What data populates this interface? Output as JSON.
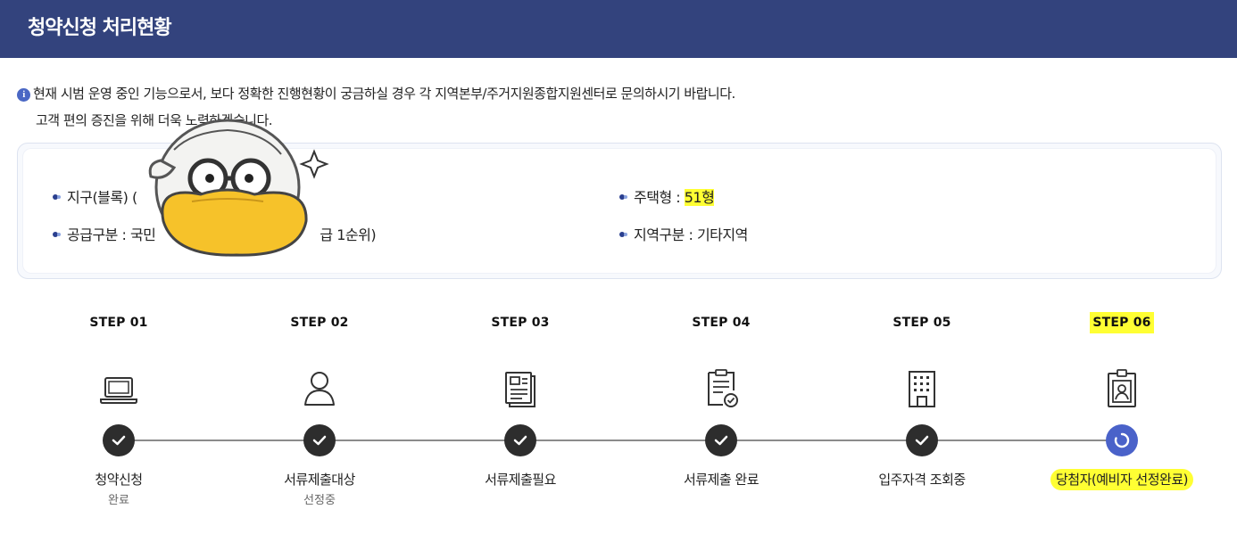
{
  "header": {
    "title": "청약신청 처리현황"
  },
  "notice": {
    "icon": "info-icon",
    "line1": "현재 시범 운영 중인 기능으로서, 보다 정확한 진행현황이 궁금하실 경우 각 지역본부/주거지원종합지원센터로 문의하시기 바랍니다.",
    "line2": "고객 편의 증진을 위해 더욱 노력하겠습니다."
  },
  "info": {
    "district_label": "지구(블록)",
    "district_value": "(",
    "housing_type_label": "주택형 : ",
    "housing_type_value": "51형",
    "supply_label": "공급구분 : 국민",
    "supply_value_tail": "급 1순위)",
    "region_label": "지역구분 : 기타지역"
  },
  "steps": [
    {
      "label": "STEP 01",
      "icon": "laptop-icon",
      "status": "청약신청",
      "sub": "완료",
      "state": "done"
    },
    {
      "label": "STEP 02",
      "icon": "person-icon",
      "status": "서류제출대상",
      "sub": "선정중",
      "state": "done"
    },
    {
      "label": "STEP 03",
      "icon": "document-icon",
      "status": "서류제출필요",
      "sub": "",
      "state": "done"
    },
    {
      "label": "STEP 04",
      "icon": "document-check-icon",
      "status": "서류제출 완료",
      "sub": "",
      "state": "done"
    },
    {
      "label": "STEP 05",
      "icon": "building-icon",
      "status": "입주자격 조회중",
      "sub": "",
      "state": "done"
    },
    {
      "label": "STEP 06",
      "icon": "id-badge-icon",
      "status": "당첨자(예비자 선정완료)",
      "sub": "",
      "state": "active"
    }
  ],
  "colors": {
    "header_bg": "#33437d",
    "highlight": "#ffff33",
    "done_circle": "#2d2d2d",
    "active_circle": "#4a62c9"
  }
}
